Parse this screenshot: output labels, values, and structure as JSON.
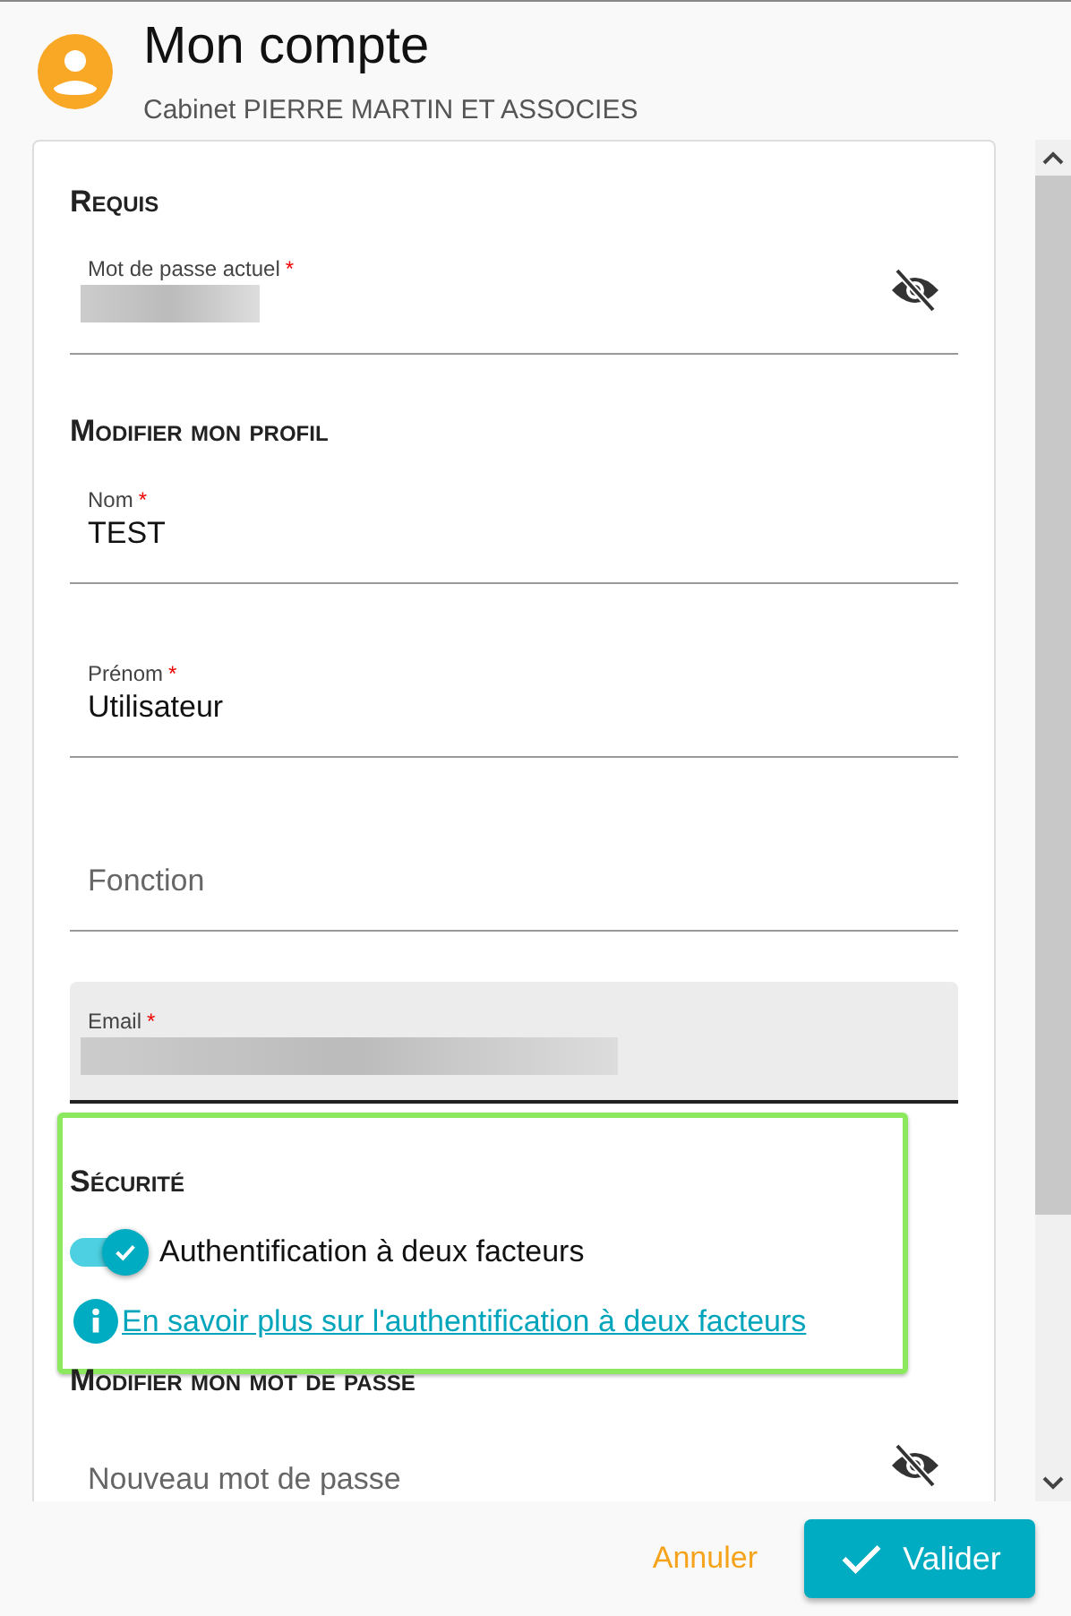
{
  "header": {
    "title": "Mon compte",
    "subtitle": "Cabinet PIERRE MARTIN ET ASSOCIES"
  },
  "sections": [
    {
      "heading": "Requis",
      "fields": [
        {
          "kind": "password",
          "label": "Mot de passe actuel",
          "required_mark": "*",
          "value_hidden": true,
          "password_visible": false
        }
      ]
    },
    {
      "heading": "Modifier mon profil",
      "fields": [
        {
          "kind": "text",
          "label": "Nom",
          "required_mark": "*",
          "value": "TEST"
        },
        {
          "kind": "text",
          "label": "Prénom",
          "required_mark": "*",
          "value": "Utilisateur"
        },
        {
          "kind": "text",
          "placeholder": "Fonction"
        },
        {
          "kind": "filled",
          "label": "Email",
          "required_mark": "*",
          "value_hidden": true
        }
      ]
    },
    {
      "heading": "Sécurité",
      "highlighted": true,
      "toggle": {
        "label": "Authentification à deux facteurs",
        "on": true
      },
      "link": "En savoir plus sur l'authentification à deux facteurs"
    },
    {
      "heading": "Modifier mon mot de passe",
      "fields": [
        {
          "kind": "password",
          "placeholder": "Nouveau mot de passe",
          "password_visible": false
        }
      ]
    }
  ],
  "footer": {
    "cancel": "Annuler",
    "submit": "Valider"
  }
}
